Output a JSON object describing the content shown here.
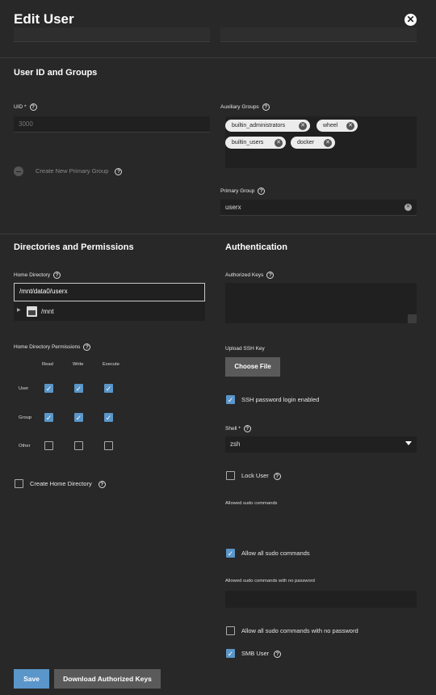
{
  "header": {
    "title": "Edit User",
    "close_icon": "close-icon"
  },
  "user_id_groups": {
    "title": "User ID and Groups",
    "uid_label": "UID *",
    "uid_value": "3000",
    "create_primary_group_label": "Create New Primary Group",
    "aux_groups_label": "Auxiliary Groups",
    "aux_groups": [
      "builtin_administrators",
      "wheel",
      "builtin_users",
      "docker"
    ],
    "primary_group_label": "Primary Group",
    "primary_group_value": "userx"
  },
  "directories": {
    "title": "Directories and Permissions",
    "home_dir_label": "Home Directory",
    "home_dir_value": "/mnt/data0/userx",
    "tree_item": "/mnt",
    "perm_label": "Home Directory Permissions",
    "perm_columns": [
      "Read",
      "Write",
      "Execute"
    ],
    "perm_rows": [
      {
        "name": "User",
        "values": [
          true,
          true,
          true
        ]
      },
      {
        "name": "Group",
        "values": [
          true,
          true,
          true
        ]
      },
      {
        "name": "Other",
        "values": [
          false,
          false,
          false
        ]
      }
    ],
    "create_home_label": "Create Home Directory",
    "create_home_checked": false
  },
  "authentication": {
    "title": "Authentication",
    "authorized_keys_label": "Authorized Keys",
    "upload_ssh_label": "Upload SSH Key",
    "choose_file_label": "Choose File",
    "ssh_password_label": "SSH password login enabled",
    "ssh_password_checked": true,
    "shell_label": "Shell *",
    "shell_value": "zsh",
    "lock_user_label": "Lock User",
    "lock_user_checked": false,
    "sudo_commands_label": "Allowed sudo commands",
    "allow_all_sudo_label": "Allow all sudo commands",
    "allow_all_sudo_checked": true,
    "sudo_nopasswd_label": "Allowed sudo commands with no password",
    "allow_all_sudo_nopasswd_label": "Allow all sudo commands with no password",
    "allow_all_sudo_nopasswd_checked": false,
    "smb_user_label": "SMB User",
    "smb_user_checked": true
  },
  "footer": {
    "save_label": "Save",
    "download_keys_label": "Download Authorized Keys"
  },
  "colors": {
    "accent": "#5a96c9",
    "background": "#282828",
    "field": "#202020"
  }
}
